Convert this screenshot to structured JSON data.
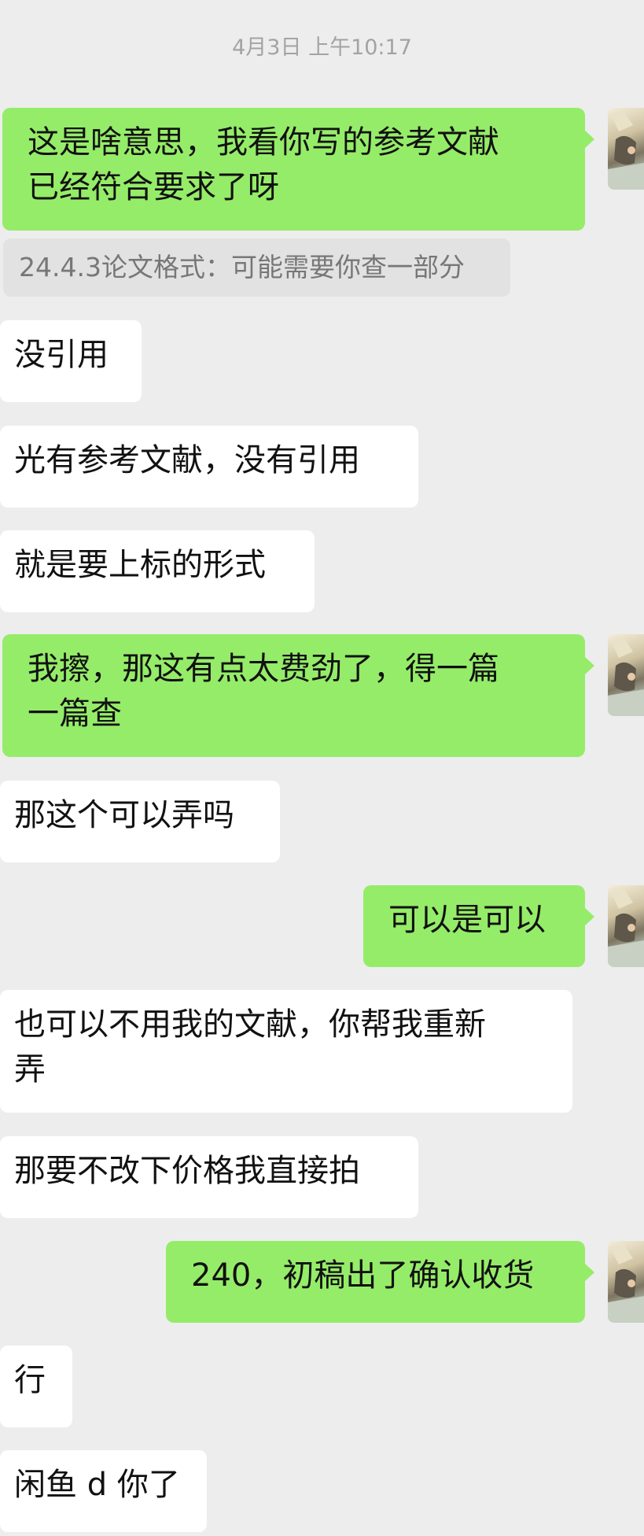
{
  "timestamp": "4月3日 上午10:17",
  "quote_text": "24.4.3论文格式：可能需要你查一部分",
  "messages": [
    {
      "id": "m1",
      "from": "me",
      "lines": [
        "这是啥意思，我看你写的参考文献",
        "已经符合要求了呀"
      ]
    },
    {
      "id": "m2",
      "from": "other",
      "lines": [
        "没引用"
      ]
    },
    {
      "id": "m3",
      "from": "other",
      "lines": [
        "光有参考文献，没有引用"
      ]
    },
    {
      "id": "m4",
      "from": "other",
      "lines": [
        "就是要上标的形式"
      ]
    },
    {
      "id": "m5",
      "from": "me",
      "lines": [
        "我擦，那这有点太费劲了，得一篇",
        "一篇查"
      ]
    },
    {
      "id": "m6",
      "from": "other",
      "lines": [
        "那这个可以弄吗"
      ]
    },
    {
      "id": "m7",
      "from": "me",
      "lines": [
        "可以是可以"
      ]
    },
    {
      "id": "m8",
      "from": "other",
      "lines": [
        "也可以不用我的文献，你帮我重新",
        "弄"
      ]
    },
    {
      "id": "m9",
      "from": "other",
      "lines": [
        "那要不改下价格我直接拍"
      ]
    },
    {
      "id": "m10",
      "from": "me",
      "lines": [
        "240，初稿出了确认收货"
      ]
    },
    {
      "id": "m11",
      "from": "other",
      "lines": [
        "行"
      ]
    },
    {
      "id": "m12",
      "from": "other",
      "lines": [
        "闲鱼 d 你了"
      ]
    }
  ],
  "colors": {
    "background": "#ededed",
    "outgoing_bubble": "#95ec69",
    "incoming_bubble": "#ffffff",
    "quote_bubble": "#e2e2e2",
    "timestamp_text": "#a3a3a3"
  },
  "icons": {
    "avatar": "user-avatar-icon"
  }
}
